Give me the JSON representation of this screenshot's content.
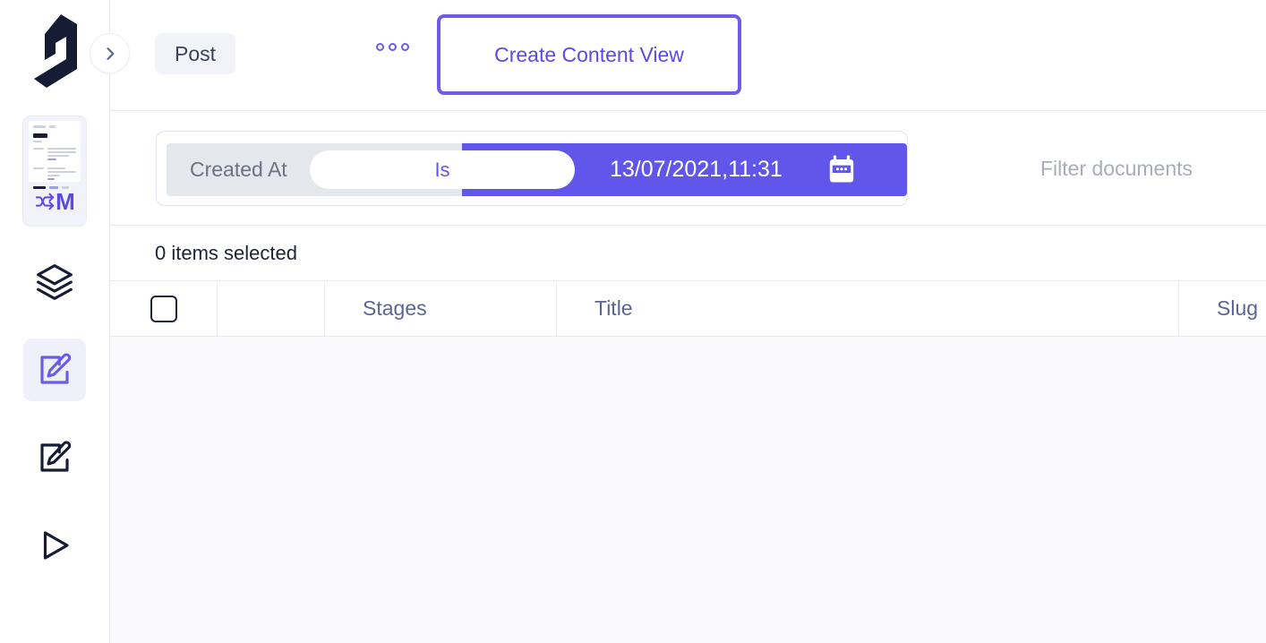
{
  "brand": {
    "logo_name": "hygraph-logo",
    "accent": "#6156ea",
    "accent_light": "#5b4ae6",
    "dark": "#1c2333"
  },
  "sidebar": {
    "expander": {
      "icon": "chevron-right-icon",
      "label": ">"
    },
    "preview_card": {
      "name": "model-preview-card",
      "logo_text": "M",
      "logo_icon": "shuffle-icon"
    },
    "items": [
      {
        "name": "sidebar-item-schema",
        "icon": "layers-icon",
        "active": false
      },
      {
        "name": "sidebar-item-content",
        "icon": "edit-square-icon",
        "active": true
      },
      {
        "name": "sidebar-item-assets",
        "icon": "edit-square-icon",
        "active": false
      },
      {
        "name": "sidebar-item-api-playground",
        "icon": "play-icon",
        "active": false
      }
    ]
  },
  "topbar": {
    "post_chip": "Post",
    "more_icon": "more-horizontal-icon",
    "create_content_view": "Create Content View"
  },
  "filterbar": {
    "field_label": "Created At",
    "operator_label": "Is",
    "value_label": "13/07/2021,11:31",
    "calendar_icon": "calendar-icon",
    "search_placeholder": "Filter documents"
  },
  "selection": {
    "status": "0 items selected"
  },
  "table": {
    "columns": [
      {
        "name": "table-col-select",
        "label": ""
      },
      {
        "name": "table-col-blank",
        "label": ""
      },
      {
        "name": "table-col-stages",
        "label": "Stages"
      },
      {
        "name": "table-col-title",
        "label": "Title"
      },
      {
        "name": "table-col-slug",
        "label": "Slug"
      }
    ],
    "rows": []
  }
}
